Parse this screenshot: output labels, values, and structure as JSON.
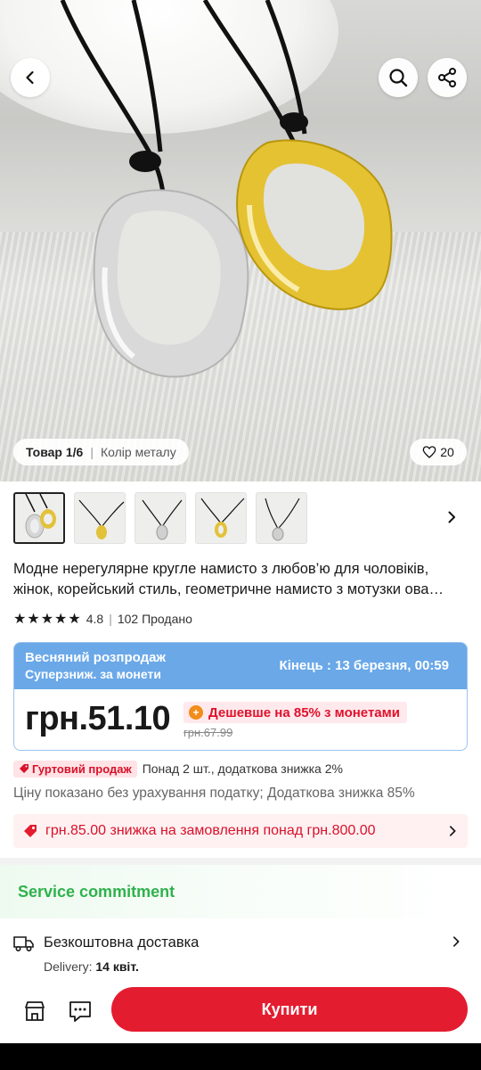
{
  "hero": {
    "image_counter": "Товар 1/6",
    "variant_label": "Колір металу",
    "likes": "20"
  },
  "icons": {
    "back": "chevron-left-icon",
    "search": "search-icon",
    "share": "share-icon",
    "heart": "heart-icon",
    "thumbs_next": "chevron-right-icon",
    "star": "star-icon",
    "coin": "coin-icon",
    "bulk": "tag-icon",
    "coupon": "coupon-icon",
    "delivery": "truck-icon",
    "store": "store-icon",
    "chat": "chat-icon"
  },
  "product": {
    "title": "Модне нерегулярне кругле намисто з любов’ю для чоловіків, жінок, корейський стиль, геометричне намисто з мотузки ова…",
    "rating": "4.8",
    "sold": "102 Продано"
  },
  "promo": {
    "sale_name": "Весняний розпродаж",
    "sale_sub": "Суперзниж. за монети",
    "ends_label": "Кінець :",
    "ends_value": "13 березня, 00:59",
    "price": "грн.51.10",
    "coin_offer": "Дешевше на 85% з монетами",
    "old_price": "грн.67.99"
  },
  "bulk": {
    "badge": "Гуртовий продаж",
    "text": "Понад 2 шт., додаткова знижка 2%"
  },
  "tax_note": "Ціну показано без урахування податку; Додаткова знижка 85%",
  "coupon": {
    "text": "грн.85.00 знижка на замовлення понад грн.800.00"
  },
  "service": {
    "title": "Service commitment"
  },
  "delivery": {
    "title": "Безкоштовна доставка",
    "label": "Delivery:",
    "date": "14 квіт."
  },
  "bottom": {
    "buy_label": "Купити"
  },
  "colors": {
    "brand_red": "#e41c2f",
    "promo_blue": "#6aa8e8",
    "service_green": "#2fb24c"
  }
}
